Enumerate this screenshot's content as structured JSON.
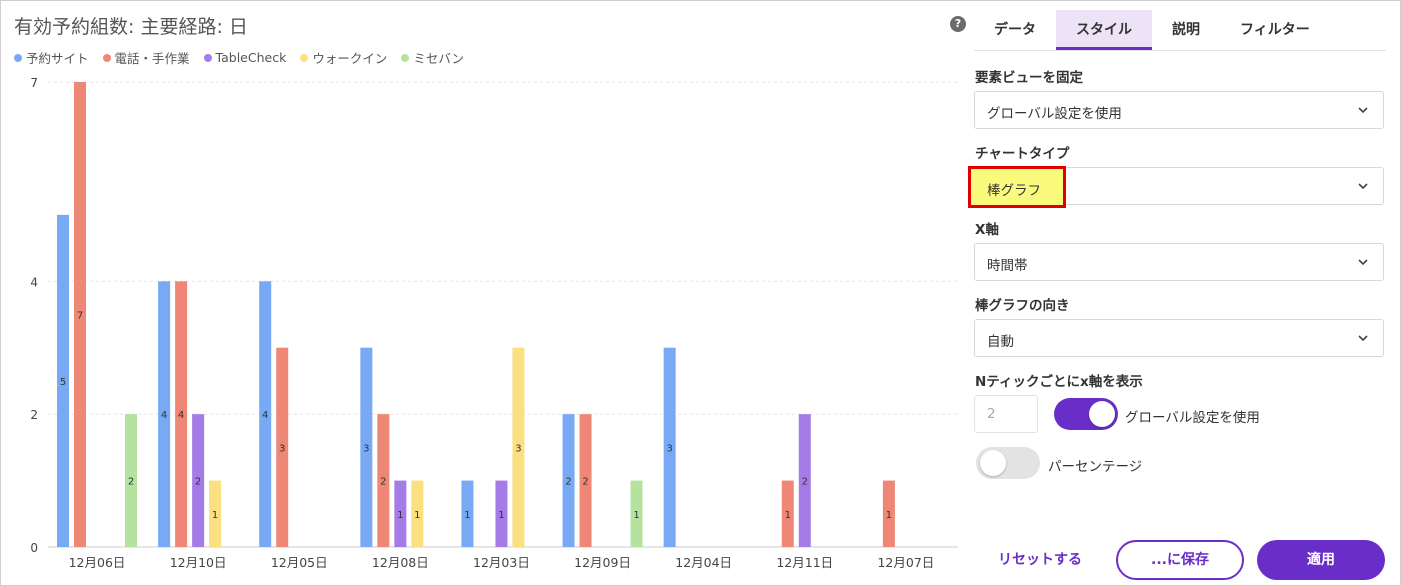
{
  "chart_title": "有効予約組数: 主要経路: 日",
  "chart_data": {
    "type": "bar",
    "title": "有効予約組数: 主要経路: 日",
    "categories": [
      "12月06日",
      "12月10日",
      "12月05日",
      "12月08日",
      "12月03日",
      "12月09日",
      "12月04日",
      "12月11日",
      "12月07日"
    ],
    "series": [
      {
        "name": "予約サイト",
        "color": "#78a9f5",
        "values": [
          5,
          4,
          4,
          3,
          1,
          2,
          3,
          0,
          0
        ]
      },
      {
        "name": "電話・手作業",
        "color": "#ef8777",
        "values": [
          7,
          4,
          3,
          2,
          0,
          2,
          0,
          1,
          1
        ]
      },
      {
        "name": "TableCheck",
        "color": "#a57be8",
        "values": [
          0,
          2,
          0,
          1,
          1,
          0,
          0,
          2,
          0
        ]
      },
      {
        "name": "ウォークイン",
        "color": "#fbe081",
        "values": [
          0,
          1,
          0,
          1,
          3,
          0,
          0,
          0,
          0
        ]
      },
      {
        "name": "ミセバン",
        "color": "#b4e3a0",
        "values": [
          2,
          0,
          0,
          0,
          0,
          1,
          0,
          0,
          0
        ]
      }
    ],
    "yticks": [
      0,
      2,
      4,
      7
    ],
    "ylim": [
      0,
      7
    ],
    "xlabel": "",
    "ylabel": "",
    "grid": true,
    "legend": "top-left"
  },
  "panel": {
    "help_icon": "help-icon",
    "help_glyph": "?",
    "tabs": [
      {
        "label": "データ",
        "active": false
      },
      {
        "label": "スタイル",
        "active": true
      },
      {
        "label": "説明",
        "active": false
      },
      {
        "label": "フィルター",
        "active": false
      }
    ],
    "fields": {
      "pin_label": "要素ビューを固定",
      "pin_value": "グローバル設定を使用",
      "chart_type_label": "チャートタイプ",
      "chart_type_value": "棒グラフ",
      "x_axis_label": "X軸",
      "x_axis_value": "時間帯",
      "bar_dir_label": "棒グラフの向き",
      "bar_dir_value": "自動",
      "n_tick_label": "Nティックごとにx軸を表示",
      "n_tick_value": "2",
      "global_toggle_label": "グローバル設定を使用",
      "percent_toggle_label": "パーセンテージ"
    },
    "buttons": {
      "reset": "リセットする",
      "save": "...に保存",
      "apply": "適用"
    },
    "accent_color": "#6a2ec8",
    "highlight_color": "#e00000"
  }
}
